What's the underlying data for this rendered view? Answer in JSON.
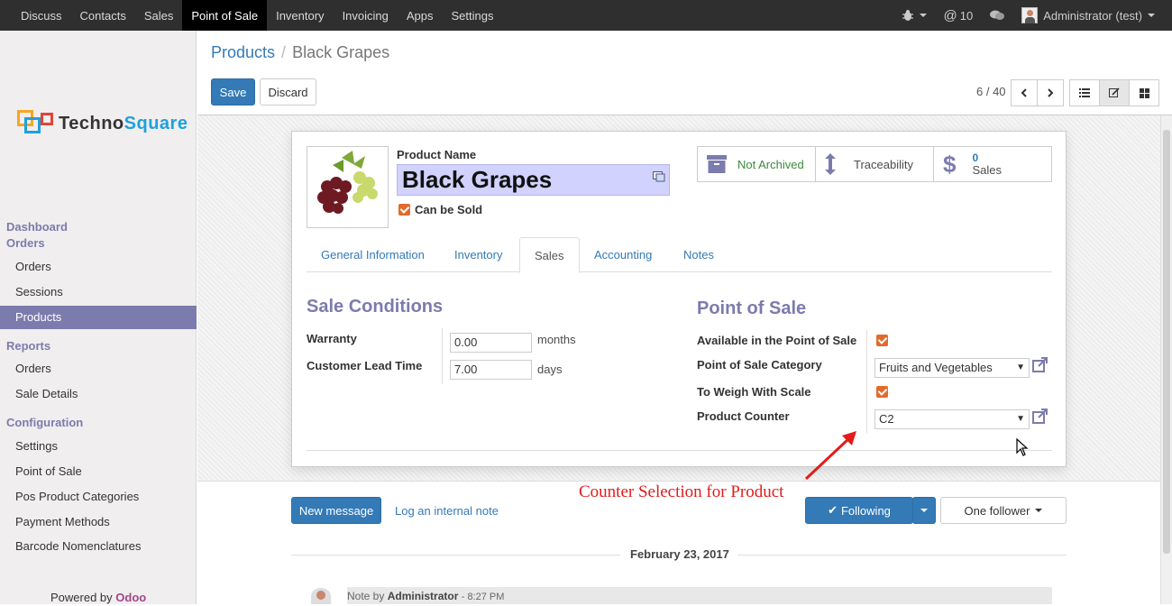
{
  "topbar": {
    "apps": [
      "Discuss",
      "Contacts",
      "Sales",
      "Point of Sale",
      "Inventory",
      "Invoicing",
      "Apps",
      "Settings"
    ],
    "active_app": "Point of Sale",
    "notifications_count": "10",
    "user": "Administrator (test)"
  },
  "sidebar": {
    "brand_left": "Techno",
    "brand_right": "Square",
    "sections": [
      {
        "title": "Dashboard"
      },
      {
        "title": "Orders",
        "items": [
          "Orders",
          "Sessions",
          "Products"
        ]
      },
      {
        "title": "Reports",
        "items": [
          "Orders",
          "Sale Details"
        ]
      },
      {
        "title": "Configuration",
        "items": [
          "Settings",
          "Point of Sale",
          "Pos Product Categories",
          "Payment Methods",
          "Barcode Nomenclatures"
        ]
      }
    ],
    "active_item": "Products",
    "powered_by": "Powered by",
    "powered_brand": "Odoo"
  },
  "control_panel": {
    "breadcrumb": {
      "parent": "Products",
      "separator": "/",
      "current": "Black Grapes"
    },
    "save_label": "Save",
    "discard_label": "Discard",
    "pager": "6 / 40"
  },
  "form": {
    "product_name_label": "Product Name",
    "product_name": "Black Grapes",
    "can_be_sold_label": "Can be Sold",
    "can_be_sold": true,
    "stat_buttons": {
      "archive": "Not Archived",
      "traceability": "Traceability",
      "sales_count": "0",
      "sales_label": "Sales"
    },
    "tabs": [
      "General Information",
      "Inventory",
      "Sales",
      "Accounting",
      "Notes"
    ],
    "active_tab": "Sales",
    "sale_conditions": {
      "title": "Sale Conditions",
      "warranty_label": "Warranty",
      "warranty_value": "0.00",
      "warranty_unit": "months",
      "lead_time_label": "Customer Lead Time",
      "lead_time_value": "7.00",
      "lead_time_unit": "days"
    },
    "point_of_sale": {
      "title": "Point of Sale",
      "available_label": "Available in the Point of Sale",
      "available": true,
      "category_label": "Point of Sale Category",
      "category_value": "Fruits and Vegetables",
      "weigh_label": "To Weigh With Scale",
      "weigh": true,
      "counter_label": "Product Counter",
      "counter_value": "C2"
    }
  },
  "annotation": "Counter Selection for Product",
  "chatter": {
    "new_message": "New message",
    "log_note": "Log an internal note",
    "following": "Following",
    "followers": "One follower",
    "date": "February 23, 2017",
    "note_prefix": "Note by",
    "note_author": "Administrator",
    "note_time": "- 8:27 PM"
  },
  "colors": {
    "accent": "#7c7bad",
    "primary": "#337ab7",
    "check": "#e26a2c",
    "annotation": "#e31b1b"
  }
}
